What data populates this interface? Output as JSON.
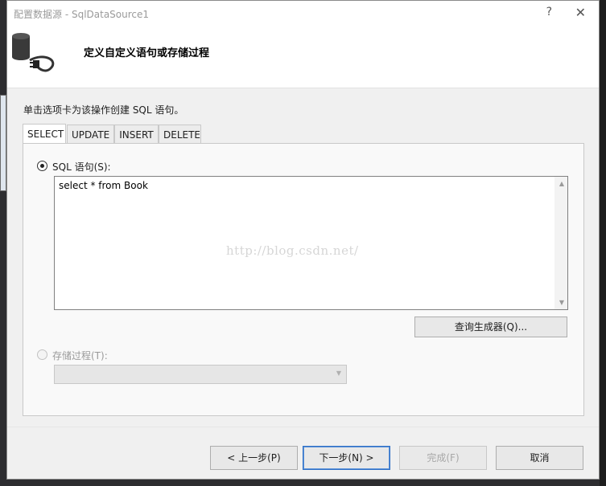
{
  "window": {
    "title": "配置数据源 - SqlDataSource1",
    "help_glyph": "?",
    "close_glyph": "✕"
  },
  "header": {
    "title": "定义自定义语句或存储过程",
    "icon": "database-connect-icon"
  },
  "instruction": "单击选项卡为该操作创建 SQL 语句。",
  "tabs": [
    {
      "label": "SELECT",
      "active": true
    },
    {
      "label": "UPDATE",
      "active": false
    },
    {
      "label": "INSERT",
      "active": false
    },
    {
      "label": "DELETE",
      "active": false
    }
  ],
  "sql": {
    "radio_label": "SQL 语句(S):",
    "checked": true,
    "value": "select * from Book"
  },
  "query_builder_label": "查询生成器(Q)...",
  "stored_procedure": {
    "radio_label": "存储过程(T):",
    "enabled": false,
    "selected": ""
  },
  "watermark": "http://blog.csdn.net/",
  "buttons": {
    "prev": "< 上一步(P)",
    "next": "下一步(N) >",
    "finish": "完成(F)",
    "cancel": "取消"
  }
}
